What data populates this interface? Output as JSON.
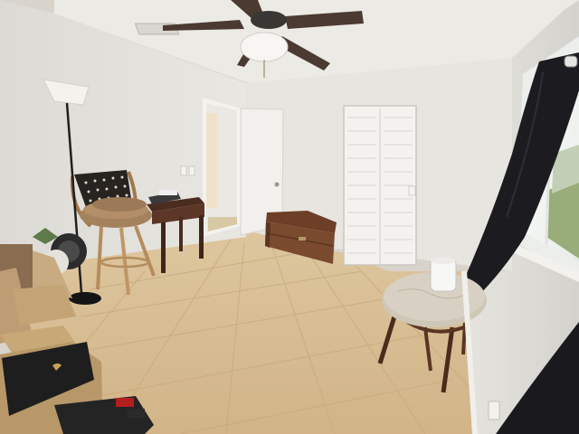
{
  "scene": {
    "kind": "photo",
    "subject": "empty bedroom",
    "features": [
      "ceiling-fan",
      "floor-lamp",
      "rattan-bar-stool",
      "side-table",
      "wooden-chest",
      "bifold-closet-door",
      "open-doorway",
      "window-with-curtain",
      "marble-top-side-table",
      "smart-speaker",
      "stored-boxes",
      "ceramic-tile-floor"
    ]
  },
  "colors": {
    "wall": "#e6e4df",
    "ceiling": "#ecebe6",
    "floor": "#d9bf94",
    "floor_line": "#c7ab7f",
    "wood_dark": "#5a3524",
    "wood_mid": "#7a4a2e",
    "curtain": "#1a1a1e",
    "window_light": "#f4f7f6",
    "greenery": "#8aa06a",
    "door": "#f1f0ec",
    "marble": "#cfc7b8"
  }
}
